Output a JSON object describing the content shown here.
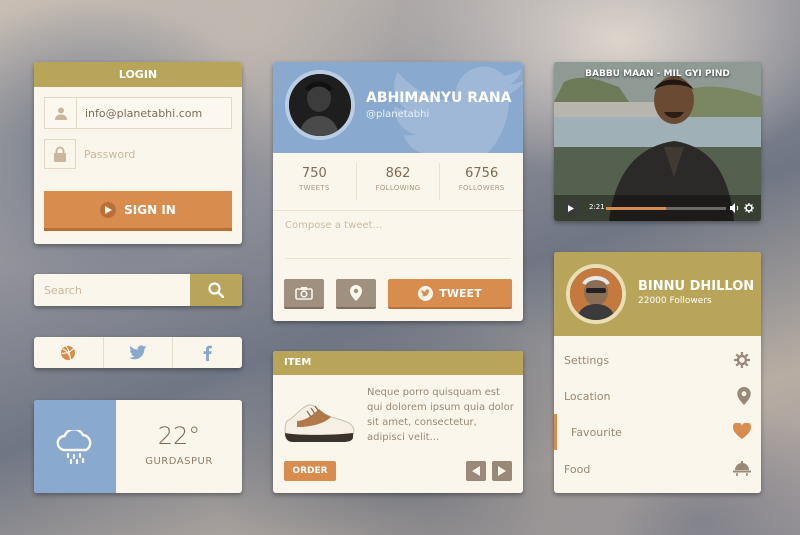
{
  "colors": {
    "gold": "#b9a55a",
    "orange": "#d88c4e",
    "blue": "#8aa9cf",
    "cream": "#fbf6ec",
    "brown_text": "#7d6b55"
  },
  "login": {
    "title": "LOGIN",
    "email_value": "info@planetabhi.com",
    "password_placeholder": "Password",
    "signin_label": "SIGN IN",
    "icons": [
      "user-icon",
      "lock-icon",
      "play-icon"
    ]
  },
  "search": {
    "placeholder": "Search",
    "icon": "search-icon"
  },
  "social": {
    "icons": [
      "dribbble-icon",
      "twitter-icon",
      "facebook-icon"
    ]
  },
  "weather": {
    "temperature": "22°",
    "city": "GURDASPUR",
    "icon": "rain-cloud-icon"
  },
  "profile": {
    "name": "ABHIMANYU RANA",
    "handle": "@planetabhi",
    "stats": [
      {
        "value": "750",
        "label": "TWEETS"
      },
      {
        "value": "862",
        "label": "FOLLOWING"
      },
      {
        "value": "6756",
        "label": "FOLLOWERS"
      }
    ],
    "compose_placeholder": "Compose a tweet...",
    "tweet_label": "TWEET",
    "icons": [
      "camera-icon",
      "location-pin-icon",
      "twitter-icon"
    ]
  },
  "item": {
    "title": "ITEM",
    "description": "Neque porro quisquam est qui dolorem ipsum quia dolor sit amet, consectetur, adipisci velit...",
    "order_label": "ORDER",
    "icons": [
      "shoe-image",
      "arrow-left-icon",
      "arrow-right-icon"
    ]
  },
  "video": {
    "title": "BABBU MAAN - MIL GYI PIND",
    "time": "2:21",
    "progress": 0.5,
    "icons": [
      "play-icon",
      "volume-icon",
      "gear-icon"
    ]
  },
  "usermenu": {
    "name": "BINNU DHILLON",
    "followers": "22000 Followers",
    "items": [
      {
        "label": "Settings",
        "icon": "gear-icon"
      },
      {
        "label": "Location",
        "icon": "location-pin-icon"
      },
      {
        "label": "Favourite",
        "icon": "heart-icon"
      },
      {
        "label": "Food",
        "icon": "food-tray-icon"
      }
    ]
  }
}
